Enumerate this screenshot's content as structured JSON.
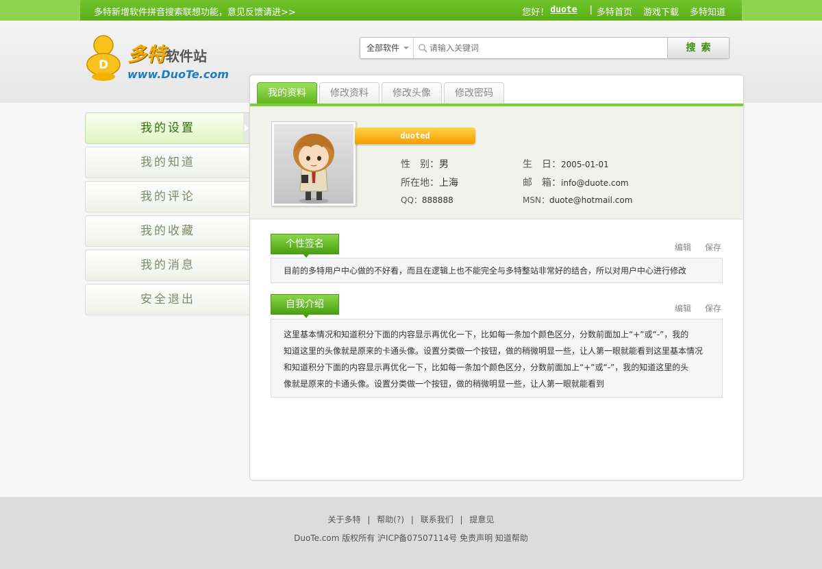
{
  "topbar": {
    "notice": "多特新增软件拼音搜索联想功能，意见反馈请进>>",
    "greeting": "您好！",
    "username": "duote",
    "separator": "|",
    "links": [
      "多特首页",
      "游戏下载",
      "多特知道"
    ]
  },
  "logo": {
    "cn_main": "多特",
    "cn_sub": "软件站",
    "url": "www.DuoTe.com",
    "badge_letter": "D"
  },
  "search": {
    "scope": "全部软件",
    "placeholder": "请输入关键词",
    "button": "搜索"
  },
  "sidemenu": {
    "items": [
      "我的设置",
      "我的知道",
      "我的评论",
      "我的收藏",
      "我的消息",
      "安全退出"
    ],
    "active_index": 0
  },
  "tabs": {
    "items": [
      "我的资料",
      "修改资料",
      "修改头像",
      "修改密码"
    ],
    "active_index": 0
  },
  "profile": {
    "username": "duoted",
    "gender_label": "性　别：",
    "gender": "男",
    "location_label": "所在地：",
    "location": "上海",
    "qq_label": "QQ：",
    "qq": "888888",
    "birthday_label": "生　日：",
    "birthday": "2005-01-01",
    "email_label": "邮　箱：",
    "email": "info@duote.com",
    "msn_label": "MSN：",
    "msn": "duote@hotmail.com"
  },
  "signature": {
    "title": "个性签名",
    "edit": "编辑",
    "save": "保存",
    "content": "目前的多特用户中心做的不好看，而且在逻辑上也不能完全与多特整站非常好的结合，所以对用户中心进行修改"
  },
  "intro": {
    "title": "自我介绍",
    "edit": "编辑",
    "save": "保存",
    "lines": [
      "这里基本情况和知道积分下面的内容显示再优化一下，比如每一条加个颜色区分，分数前面加上“+”或“-”，我的",
      "知道这里的头像就是原来的卡通头像。设置分类做一个按钮，做的稍微明显一些，让人第一眼就能看到这里基本情况",
      "和知道积分下面的内容显示再优化一下，比如每一条加个颜色区分，分数前面加上“+”或“-”，我的知道这里的头",
      "像就是原来的卡通头像。设置分类做一个按钮，做的稍微明显一些，让人第一眼就能看到"
    ]
  },
  "footer": {
    "links": [
      "关于多特",
      "帮助(?)",
      "联系我们",
      "提意见"
    ],
    "separator": "|",
    "copyright": "DuoTe.com 版权所有 沪ICP备07507114号 免责声明 知道帮助"
  },
  "colors": {
    "brand_green": "#5aae18",
    "accent_orange": "#f49d00",
    "link_blue": "#1d7cc3"
  }
}
